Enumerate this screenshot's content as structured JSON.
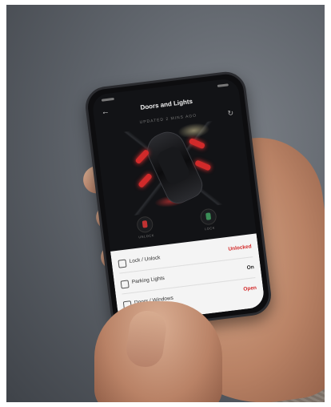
{
  "app": {
    "title": "Doors and Lights",
    "subtitle": "UPDATED 2 MINS AGO",
    "back_icon": "arrow-left-icon",
    "refresh_icon": "refresh-icon"
  },
  "controls": {
    "unlock_label": "UNLOCK",
    "lock_label": "LOCK"
  },
  "rows": [
    {
      "icon": "lock-icon",
      "label": "Lock / Unlock",
      "value": "Unlocked",
      "value_color": "#d32b2b"
    },
    {
      "icon": "parking-lights-icon",
      "label": "Parking Lights",
      "value": "On",
      "value_color": "#222222"
    },
    {
      "icon": "car-door-icon",
      "label": "Doors / Windows",
      "value": "Open",
      "value_color": "#d32b2b"
    }
  ]
}
